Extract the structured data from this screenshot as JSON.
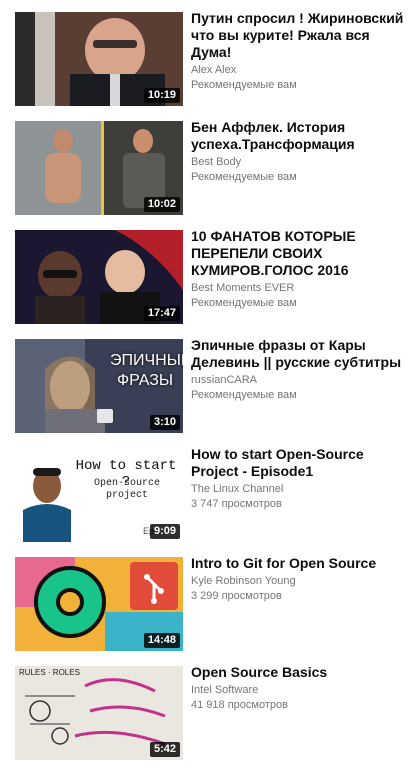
{
  "videos": [
    {
      "title": "Путин спросил ! Жириновский что вы курите! Ржала вся Дума!",
      "channel": "Alex Alex",
      "meta": "Рекомендуемые вам",
      "duration": "10:19",
      "thumb_color": "#6b4a3a"
    },
    {
      "title": "Бен Аффлек. История успеха.Трансформация",
      "channel": "Best Body",
      "meta": "Рекомендуемые вам",
      "duration": "10:02",
      "thumb_color": "#8a8f93"
    },
    {
      "title": "10 ФАНАТОВ КОТОРЫЕ ПЕРЕПЕЛИ СВОИХ КУМИРОВ.ГОЛОС 2016",
      "channel": "Best Moments EVER",
      "meta": "Рекомендуемые вам",
      "duration": "17:47",
      "thumb_color": "#1d1a2e"
    },
    {
      "title": "Эпичные фразы от Кары Делевинь || русские субтитры",
      "channel": "russianCARA",
      "meta": "Рекомендуемые вам",
      "duration": "3:10",
      "thumb_color": "#3a3f55",
      "overlay_text": "ЭПИЧНЫЕ ФРАЗЫ"
    },
    {
      "title": "How to start Open-Source Project - Episode1",
      "channel": "The Linux Channel",
      "meta": "3 747 просмотров",
      "duration": "9:09",
      "thumb_color": "#ffffff",
      "overlay_text": "How to start ?",
      "overlay_sub": "Open-source project",
      "overlay_tag": "Ep"
    },
    {
      "title": "Intro to Git for Open Source",
      "channel": "Kyle Robinson Young",
      "meta": "3 299 просмотров",
      "duration": "14:48",
      "thumb_color": "#f2b23a"
    },
    {
      "title": "Open Source Basics",
      "channel": "Intel Software",
      "meta": "41 918 просмотров",
      "duration": "5:42",
      "thumb_color": "#e9e7df",
      "overlay_text": "RULES · ROLES"
    }
  ]
}
